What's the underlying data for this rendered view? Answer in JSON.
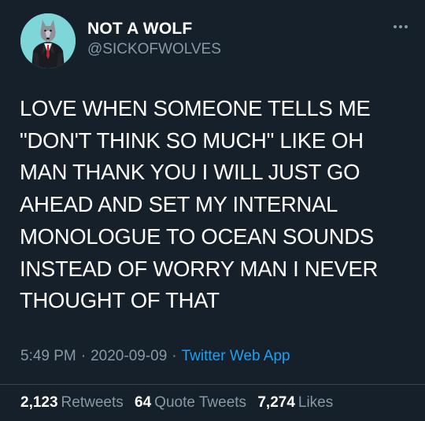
{
  "author": {
    "display_name": "NOT A WOLF",
    "handle": "@SICKOFWOLVES",
    "avatar_icon": "wolf-in-suit-avatar",
    "avatar_bg": "#7fd6d9"
  },
  "tweet": {
    "text": "LOVE WHEN SOMEONE TELLS ME\n\"DON'T THINK SO MUCH\" LIKE OH\nMAN THANK YOU I WILL JUST GO\nAHEAD AND SET MY INTERNAL\nMONOLOGUE TO OCEAN SOUNDS\nINSTEAD OF WORRY MAN I NEVER\nTHOUGHT OF THAT"
  },
  "meta": {
    "time": "5:49 PM",
    "separator": "·",
    "date": "2020-09-09",
    "source": "Twitter Web App"
  },
  "stats": {
    "retweets_count": "2,123",
    "retweets_label": "Retweets",
    "quotes_count": "64",
    "quotes_label": "Quote Tweets",
    "likes_count": "7,274",
    "likes_label": "Likes"
  },
  "colors": {
    "background": "#15202b",
    "primary_text": "#ffffff",
    "secondary_text": "#8899a6",
    "link": "#1da1f2",
    "divider": "#38444d"
  },
  "icons": {
    "more": "more-horizontal-icon"
  }
}
